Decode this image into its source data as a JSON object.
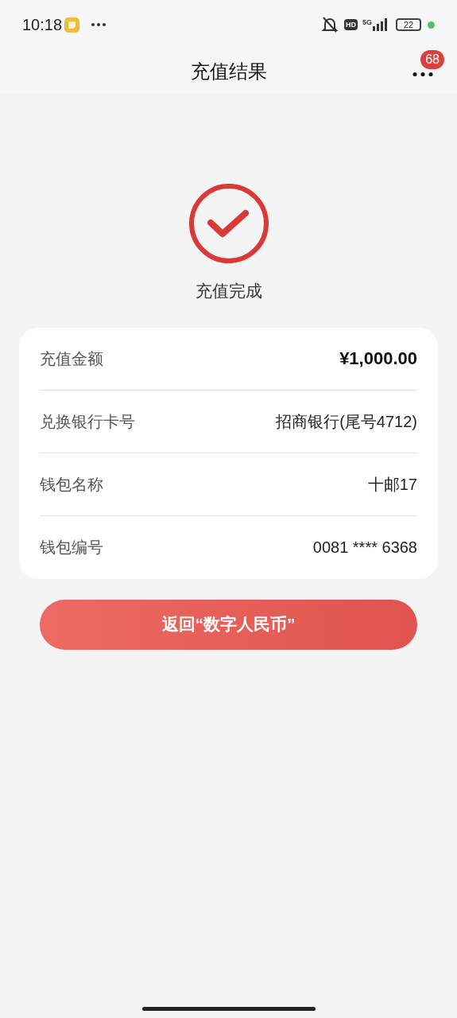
{
  "status_bar": {
    "time": "10:18",
    "hd": "HD",
    "network": "5G",
    "battery": "22"
  },
  "header": {
    "title": "充值结果",
    "badge": "68"
  },
  "result": {
    "status": "充值完成"
  },
  "details": [
    {
      "label": "充值金额",
      "value": "¥1,000.00",
      "emphasis": true
    },
    {
      "label": "兑换银行卡号",
      "value": "招商银行(尾号4712)",
      "emphasis": false
    },
    {
      "label": "钱包名称",
      "value": "十邮17",
      "emphasis": false
    },
    {
      "label": "钱包编号",
      "value": "0081 **** 6368",
      "emphasis": false
    }
  ],
  "button": {
    "label": "返回“数字人民币”"
  }
}
